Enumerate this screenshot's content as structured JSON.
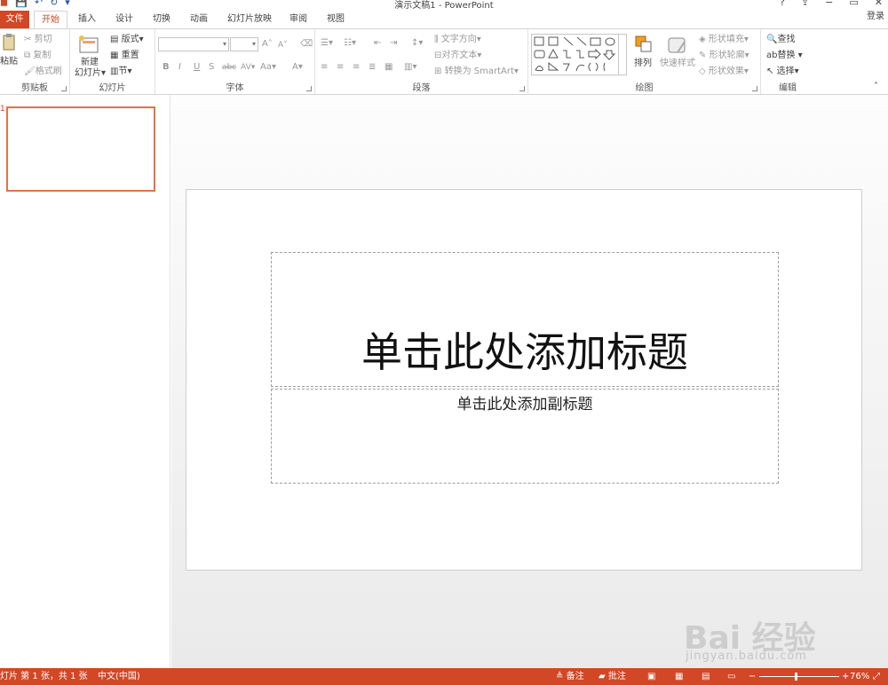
{
  "app": {
    "title": "演示文稿1 - PowerPoint",
    "login": "登录"
  },
  "qat": {
    "save": "保存",
    "undo": "撤销",
    "redo": "恢复"
  },
  "window": {
    "help": "?",
    "restore_ribbon": "⇪",
    "minimize": "−",
    "maximize": "▭",
    "close": "✕"
  },
  "tabs": [
    {
      "label": "文件"
    },
    {
      "label": "开始"
    },
    {
      "label": "插入"
    },
    {
      "label": "设计"
    },
    {
      "label": "切换"
    },
    {
      "label": "动画"
    },
    {
      "label": "幻灯片放映"
    },
    {
      "label": "审阅"
    },
    {
      "label": "视图"
    }
  ],
  "ribbon": {
    "clipboard": {
      "label": "剪贴板",
      "paste": "粘贴",
      "cut": "剪切",
      "copy": "复制",
      "format_painter": "格式刷"
    },
    "slides": {
      "label": "幻灯片",
      "new_slide": "新建",
      "new_slide2": "幻灯片",
      "layout": "版式",
      "reset": "重置",
      "section": "节"
    },
    "font": {
      "label": "字体",
      "font_name": "",
      "font_size": "",
      "bold": "B",
      "italic": "I",
      "underline": "U",
      "shadow": "S",
      "strike": "abc",
      "spacing": "AV",
      "case": "Aa",
      "color": "A",
      "grow": "A",
      "shrink": "A"
    },
    "paragraph": {
      "label": "段落",
      "text_direction": "文字方向",
      "align_text": "对齐文本",
      "smartart": "转换为 SmartArt"
    },
    "drawing": {
      "label": "绘图",
      "arrange": "排列",
      "quick_styles": "快速样式",
      "shape_fill": "形状填充",
      "shape_outline": "形状轮廓",
      "shape_effects": "形状效果"
    },
    "editing": {
      "label": "编辑",
      "find": "查找",
      "replace": "替换",
      "select": "选择"
    }
  },
  "thumbnail": {
    "number": "1"
  },
  "slide": {
    "title_placeholder": "单击此处添加标题",
    "subtitle_placeholder": "单击此处添加副标题"
  },
  "watermark": {
    "text": "Bai 经验",
    "url": "jingyan.baidu.com"
  },
  "status": {
    "slide_info": "幻灯片 第 1 张，共 1 张",
    "language": "中文(中国)",
    "notes": "备注",
    "comments": "批注",
    "zoom": "76%",
    "zoom_level": 0.46
  },
  "colors": {
    "accent": "#d24726",
    "thumb_border": "#e0734a"
  }
}
